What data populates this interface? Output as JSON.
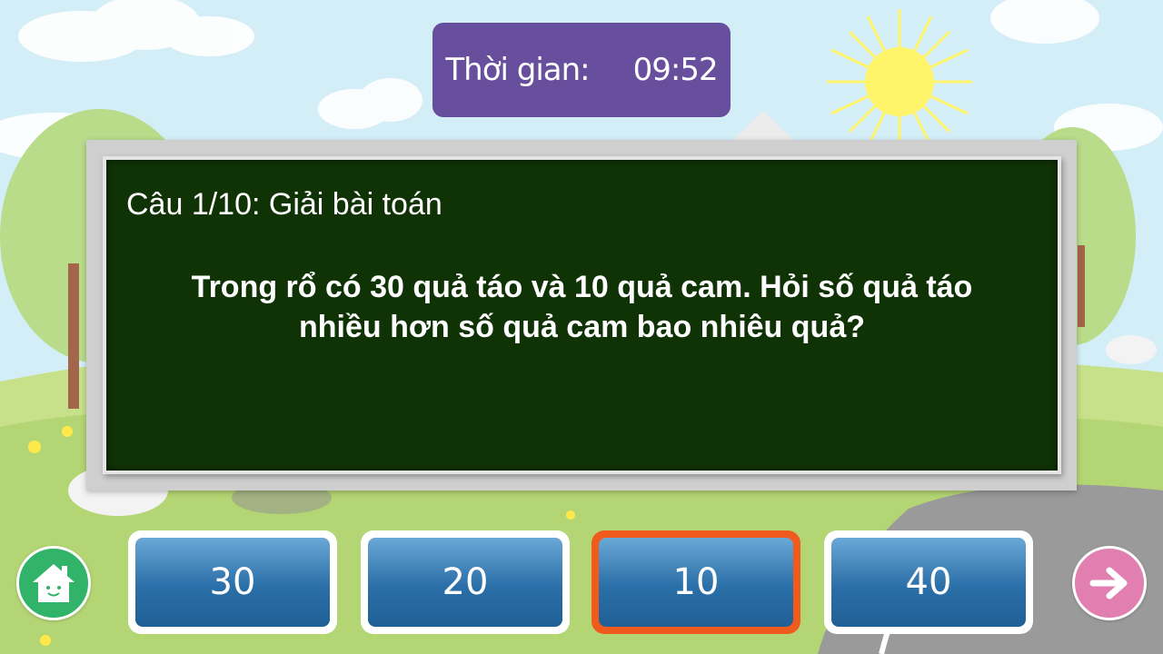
{
  "timer": {
    "label": "Thời gian:",
    "value": "09:52"
  },
  "question": {
    "header": "Câu 1/10: Giải bài toán",
    "line1": "Trong rổ có 30 quả táo và 10 quả cam. Hỏi số quả táo",
    "line2": "nhiều hơn số quả cam bao nhiêu quả?"
  },
  "answers": [
    {
      "label": "30",
      "selected": false
    },
    {
      "label": "20",
      "selected": false
    },
    {
      "label": "10",
      "selected": true
    },
    {
      "label": "40",
      "selected": false
    }
  ],
  "navigation": {
    "home_icon": "house-icon",
    "next_icon": "arrow-right-icon"
  },
  "colors": {
    "timer_bg": "#674f9e",
    "board_bg": "#103306",
    "answer_blue": "#2b6fa8",
    "selected_border": "#f05b1d",
    "home_button": "#32b36a",
    "next_button": "#e07fb0"
  }
}
